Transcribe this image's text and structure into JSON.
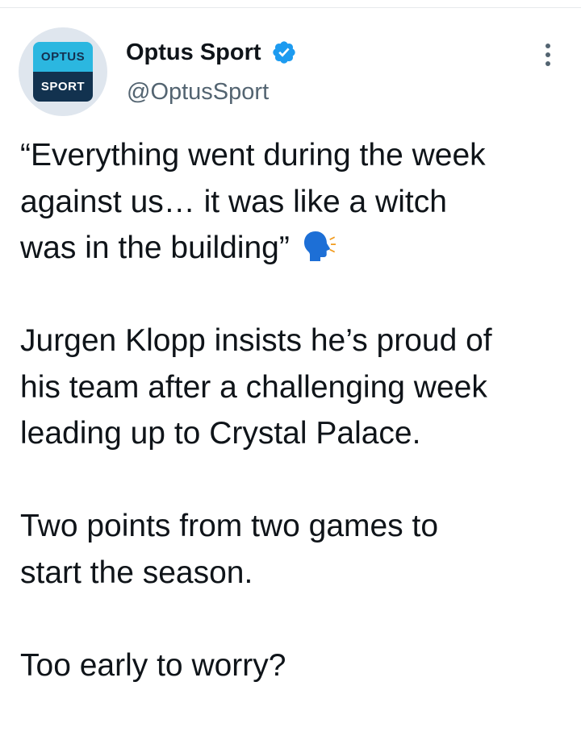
{
  "account": {
    "display_name": "Optus Sport",
    "handle": "@OptusSport",
    "verified": true,
    "avatar": {
      "logo_top_text": "OPTUS",
      "logo_bottom_text": "SPORT",
      "logo_top_color": "#2bb7e0",
      "logo_bottom_color": "#12324f"
    }
  },
  "tweet": {
    "quote_lines": [
      "“Everything went during the week",
      "against us… it was like a witch",
      "was in the building”"
    ],
    "quote_emoji_icon": "speaking-head-icon",
    "paragraph_2_lines": [
      "Jurgen Klopp insists he’s proud of",
      "his team after a challenging week",
      "leading up to Crystal Palace."
    ],
    "paragraph_3_lines": [
      "Two points from two games to",
      "start the season."
    ],
    "paragraph_4_lines": [
      "Too early to worry?"
    ]
  },
  "icons": {
    "verified": "verified-badge-icon",
    "more": "more-options-icon"
  },
  "colors": {
    "text_primary": "#0f1419",
    "text_secondary": "#536471",
    "verified_blue": "#1d9bf0",
    "emoji_blue": "#1d6fd6",
    "emoji_orange": "#f29b1d"
  }
}
